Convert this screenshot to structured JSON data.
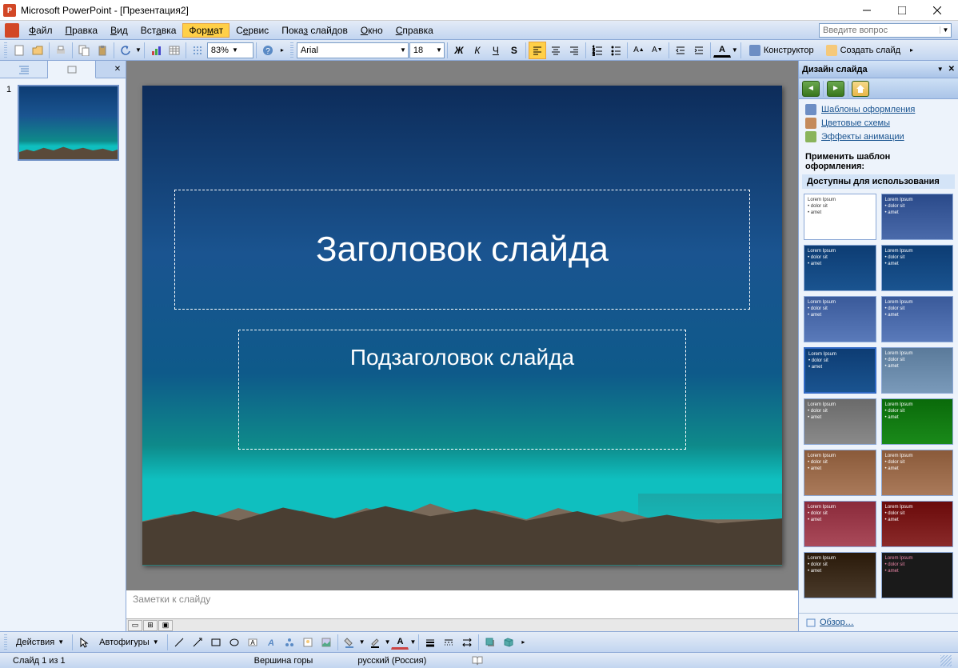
{
  "title": "Microsoft PowerPoint - [Презентация2]",
  "menu": {
    "file": "Файл",
    "edit": "Правка",
    "view": "Вид",
    "insert": "Вставка",
    "format": "Формат",
    "service": "Сервис",
    "slideshow": "Показ слайдов",
    "window": "Окно",
    "help": "Справка"
  },
  "question_placeholder": "Введите вопрос",
  "toolbar": {
    "zoom": "83%",
    "font": "Arial",
    "font_size": "18",
    "designer": "Конструктор",
    "new_slide": "Создать слайд"
  },
  "slide": {
    "title_placeholder": "Заголовок слайда",
    "subtitle_placeholder": "Подзаголовок слайда"
  },
  "thumb": {
    "num": "1"
  },
  "notes_placeholder": "Заметки к слайду",
  "taskpane": {
    "title": "Дизайн слайда",
    "link_templates": "Шаблоны оформления",
    "link_colors": "Цветовые схемы",
    "link_animation": "Эффекты анимации",
    "apply_label": "Применить шаблон оформления:",
    "section_label": "Доступны для использования",
    "browse": "Обзор…"
  },
  "bottom_toolbar": {
    "actions": "Действия",
    "autoshapes": "Автофигуры"
  },
  "status": {
    "slide": "Слайд 1 из 1",
    "theme": "Вершина горы",
    "lang": "русский (Россия)"
  }
}
